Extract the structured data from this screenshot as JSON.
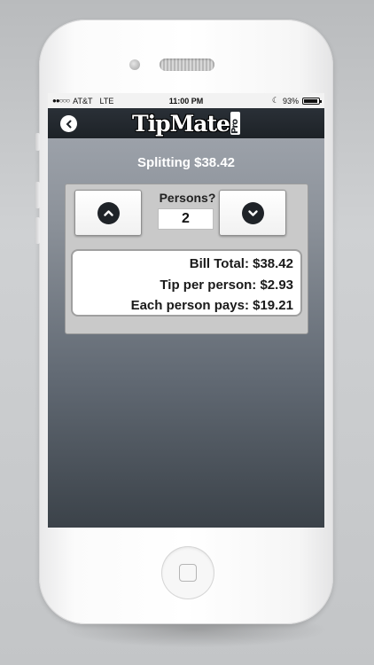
{
  "status_bar": {
    "carrier": "AT&T",
    "network": "LTE",
    "time": "11:00 PM",
    "battery": "93%",
    "battery_level": 0.93
  },
  "nav": {
    "logo_text": "TipMate",
    "logo_sub": "Pro",
    "back_icon": "chevron-left-circle-icon"
  },
  "splitting": {
    "title": "Splitting $38.42"
  },
  "persons": {
    "label": "Persons?",
    "value": "2",
    "increment_icon": "chevron-up-icon",
    "decrement_icon": "chevron-down-icon"
  },
  "summary": {
    "bill_total": "Bill Total: $38.42",
    "tip_per_person": "Tip per person: $2.93",
    "each_person_pays": "Each person pays: $19.21"
  },
  "colors": {
    "navbar": "#1d2227",
    "panel": "#c9c9c9",
    "screen_top": "#a5aab2",
    "screen_bottom": "#3b4249"
  }
}
